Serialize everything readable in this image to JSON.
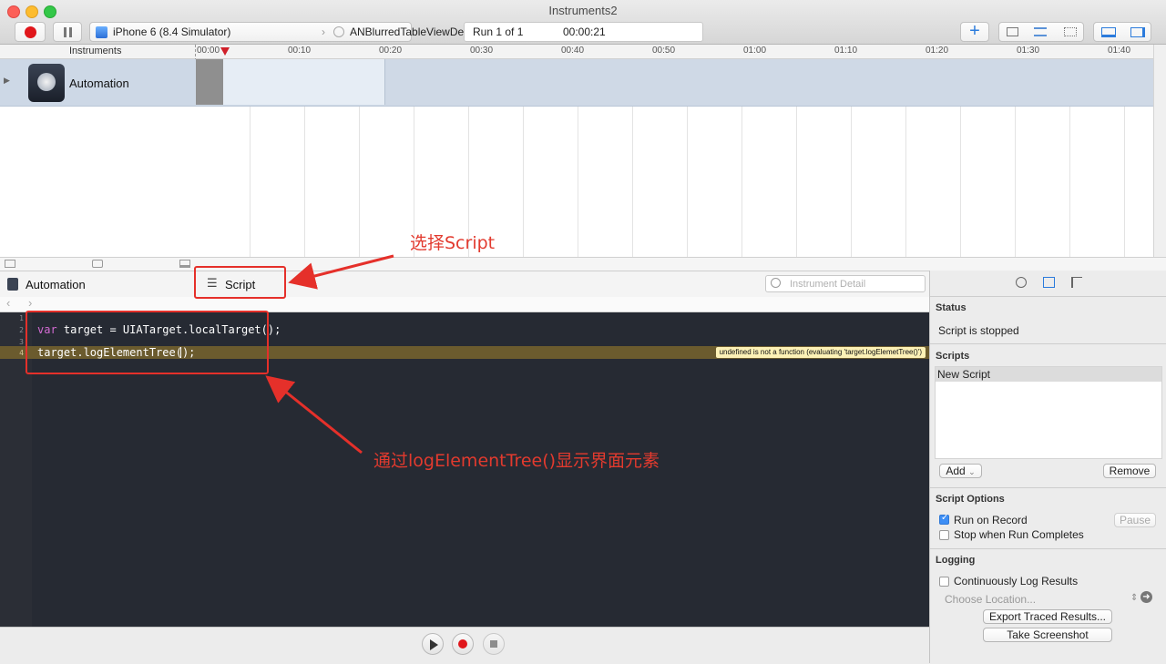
{
  "window": {
    "title": "Instruments2"
  },
  "toolbar": {
    "device": "iPhone 6 (8.4 Simulator)",
    "app": "ANBlurredTableViewDemo.app",
    "run_label": "Run 1 of 1",
    "run_time": "00:00:21"
  },
  "timeline": {
    "header": "Instruments",
    "ticks": [
      "00:00",
      "00:10",
      "00:20",
      "00:30",
      "00:40",
      "00:50",
      "01:00",
      "01:10",
      "01:20",
      "01:30",
      "01:40"
    ],
    "instrument_name": "Automation"
  },
  "detail": {
    "instrument": "Automation",
    "tab": "Script",
    "search_placeholder": "Instrument Detail"
  },
  "editor": {
    "line_numbers": [
      "1",
      "2",
      "3",
      "4"
    ],
    "line2": {
      "kw": "var",
      "rest": " target = UIATarget.localTarget();"
    },
    "line4": "target.logElementTree();",
    "error": "undefined is not a function (evaluating 'target.logElemetTree()')"
  },
  "panel": {
    "status_title": "Status",
    "status_text": "Script is stopped",
    "scripts_title": "Scripts",
    "script_item": "New Script",
    "add": "Add",
    "remove": "Remove",
    "options_title": "Script Options",
    "run_on_record": "Run on Record",
    "pause": "Pause",
    "stop_when": "Stop when Run Completes",
    "logging_title": "Logging",
    "continuous": "Continuously Log Results",
    "choose_location": "Choose Location...",
    "export": "Export Traced Results...",
    "screenshot": "Take Screenshot"
  },
  "annotations": {
    "select_script": "选择Script",
    "log_tree": "通过logElementTree()显示界面元素"
  },
  "colors": {
    "accent": "#e23a2e",
    "editor_bg": "#262a33",
    "keyword": "#d36bd3"
  }
}
